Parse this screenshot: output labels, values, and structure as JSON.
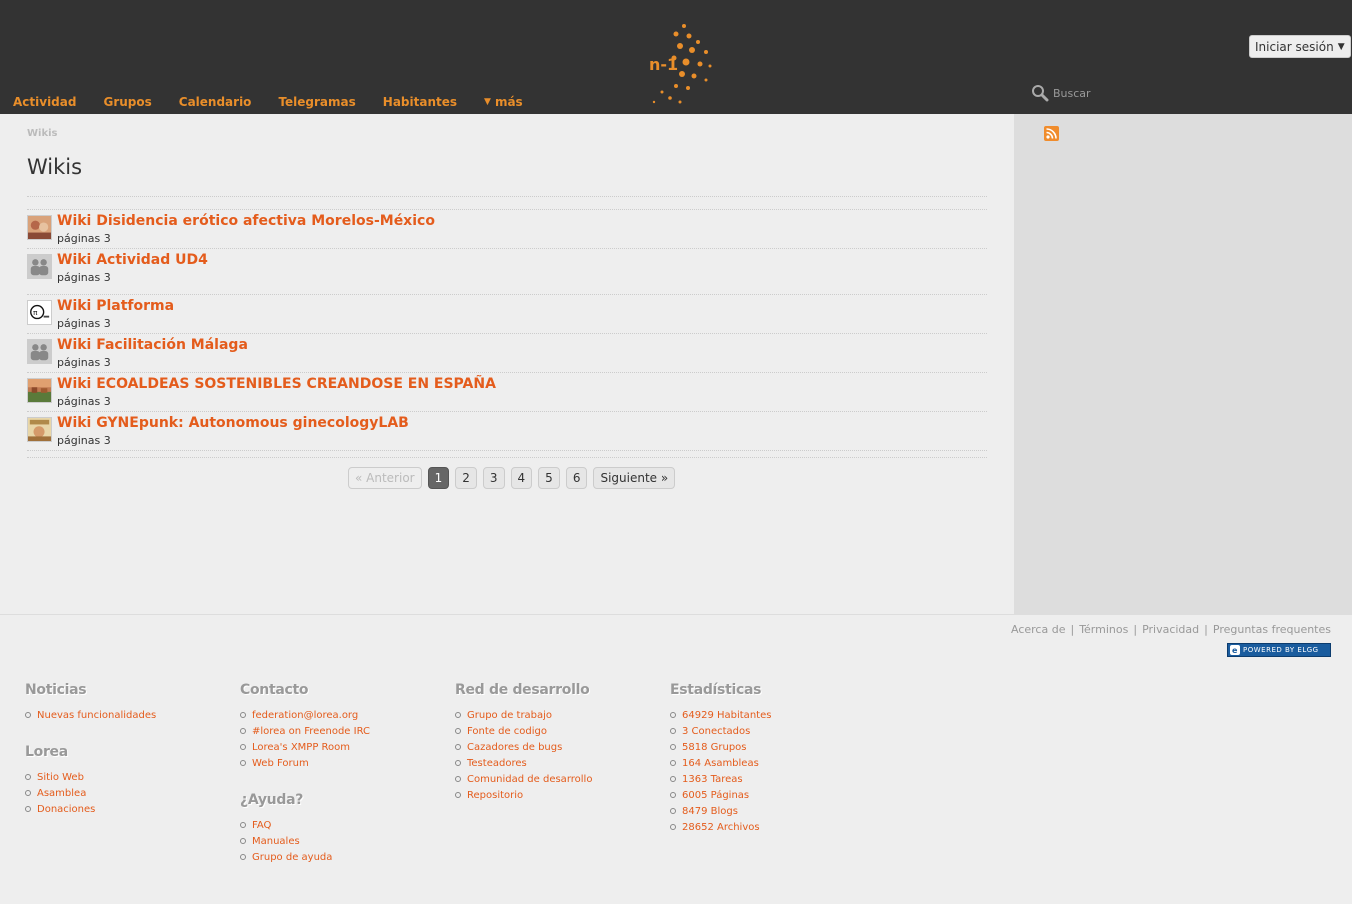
{
  "header": {
    "nav": [
      "Actividad",
      "Grupos",
      "Calendario",
      "Telegramas",
      "Habitantes"
    ],
    "more_label": "más",
    "login_label": "Iniciar sesión",
    "search_placeholder": "Buscar"
  },
  "main": {
    "breadcrumb": "Wikis",
    "title": "Wikis",
    "items": [
      {
        "title": "Wiki Disidencia erótico afectiva Morelos-México",
        "meta": "páginas 3"
      },
      {
        "title": "Wiki Actividad UD4",
        "meta": "páginas 3"
      },
      {
        "title": "Wiki Platforma",
        "meta": "páginas 3"
      },
      {
        "title": "Wiki Facilitación Málaga",
        "meta": "páginas 3"
      },
      {
        "title": "Wiki ECOALDEAS SOSTENIBLES CREANDOSE EN ESPAÑA",
        "meta": "páginas 3"
      },
      {
        "title": "Wiki GYNEpunk: Autonomous ginecologyLAB",
        "meta": "páginas 3"
      }
    ],
    "pager": {
      "prev": "« Anterior",
      "pages": [
        "1",
        "2",
        "3",
        "4",
        "5",
        "6"
      ],
      "next": "Siguiente »",
      "current": "1"
    }
  },
  "footer": {
    "links": [
      "Acerca de",
      "Términos",
      "Privacidad",
      "Preguntas frequentes"
    ],
    "link_sep": "|",
    "badge": "POWERED BY ELGG",
    "columns": {
      "noticias": {
        "title": "Noticias",
        "items": [
          "Nuevas funcionalidades"
        ]
      },
      "lorea": {
        "title": "Lorea",
        "items": [
          "Sitio Web",
          "Asamblea",
          "Donaciones"
        ]
      },
      "contacto": {
        "title": "Contacto",
        "items": [
          "federation@lorea.org",
          "#lorea on Freenode IRC",
          "Lorea's XMPP Room",
          "Web Forum"
        ]
      },
      "ayuda": {
        "title": "¿Ayuda?",
        "items": [
          "FAQ",
          "Manuales",
          "Grupo de ayuda"
        ]
      },
      "red": {
        "title": "Red de desarrollo",
        "items": [
          "Grupo de trabajo",
          "Fonte de codigo",
          "Cazadores de bugs",
          "Testeadores",
          "Comunidad de desarrollo",
          "Repositorio"
        ]
      },
      "estadisticas": {
        "title": "Estadísticas",
        "items": [
          "64929 Habitantes",
          "3 Conectados",
          "5818 Grupos",
          "164 Asambleas",
          "1363 Tareas",
          "6005 Páginas",
          "8479 Blogs",
          "28652 Archivos"
        ]
      }
    }
  },
  "colors": {
    "accent": "#e45c1c",
    "nav": "#e98e2a",
    "topbar": "#333333"
  }
}
